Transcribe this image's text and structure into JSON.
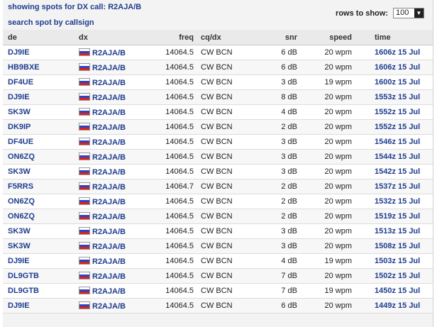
{
  "header": {
    "title_prefix": "showing spots for DX call:",
    "call": "R2AJA/B",
    "search_link": "search spot by callsign",
    "rows_label": "rows to show:",
    "rows_value": "100"
  },
  "columns": {
    "de": "de",
    "dx": "dx",
    "freq": "freq",
    "cqdx": "cq/dx",
    "snr": "snr",
    "speed": "speed",
    "time": "time"
  },
  "rows": [
    {
      "de": "DJ9IE",
      "dx": "R2AJA/B",
      "freq": "14064.5",
      "cqdx": "CW BCN",
      "snr": "6 dB",
      "speed": "20 wpm",
      "time": "1606z 15 Jul"
    },
    {
      "de": "HB9BXE",
      "dx": "R2AJA/B",
      "freq": "14064.5",
      "cqdx": "CW BCN",
      "snr": "6 dB",
      "speed": "20 wpm",
      "time": "1606z 15 Jul"
    },
    {
      "de": "DF4UE",
      "dx": "R2AJA/B",
      "freq": "14064.5",
      "cqdx": "CW BCN",
      "snr": "3 dB",
      "speed": "19 wpm",
      "time": "1600z 15 Jul"
    },
    {
      "de": "DJ9IE",
      "dx": "R2AJA/B",
      "freq": "14064.5",
      "cqdx": "CW BCN",
      "snr": "8 dB",
      "speed": "20 wpm",
      "time": "1553z 15 Jul"
    },
    {
      "de": "SK3W",
      "dx": "R2AJA/B",
      "freq": "14064.5",
      "cqdx": "CW BCN",
      "snr": "4 dB",
      "speed": "20 wpm",
      "time": "1552z 15 Jul"
    },
    {
      "de": "DK9IP",
      "dx": "R2AJA/B",
      "freq": "14064.5",
      "cqdx": "CW BCN",
      "snr": "2 dB",
      "speed": "20 wpm",
      "time": "1552z 15 Jul"
    },
    {
      "de": "DF4UE",
      "dx": "R2AJA/B",
      "freq": "14064.5",
      "cqdx": "CW BCN",
      "snr": "3 dB",
      "speed": "20 wpm",
      "time": "1546z 15 Jul"
    },
    {
      "de": "ON6ZQ",
      "dx": "R2AJA/B",
      "freq": "14064.5",
      "cqdx": "CW BCN",
      "snr": "3 dB",
      "speed": "20 wpm",
      "time": "1544z 15 Jul"
    },
    {
      "de": "SK3W",
      "dx": "R2AJA/B",
      "freq": "14064.5",
      "cqdx": "CW BCN",
      "snr": "3 dB",
      "speed": "20 wpm",
      "time": "1542z 15 Jul"
    },
    {
      "de": "F5RRS",
      "dx": "R2AJA/B",
      "freq": "14064.7",
      "cqdx": "CW BCN",
      "snr": "2 dB",
      "speed": "20 wpm",
      "time": "1537z 15 Jul"
    },
    {
      "de": "ON6ZQ",
      "dx": "R2AJA/B",
      "freq": "14064.5",
      "cqdx": "CW BCN",
      "snr": "2 dB",
      "speed": "20 wpm",
      "time": "1532z 15 Jul"
    },
    {
      "de": "ON6ZQ",
      "dx": "R2AJA/B",
      "freq": "14064.5",
      "cqdx": "CW BCN",
      "snr": "2 dB",
      "speed": "20 wpm",
      "time": "1519z 15 Jul"
    },
    {
      "de": "SK3W",
      "dx": "R2AJA/B",
      "freq": "14064.5",
      "cqdx": "CW BCN",
      "snr": "3 dB",
      "speed": "20 wpm",
      "time": "1513z 15 Jul"
    },
    {
      "de": "SK3W",
      "dx": "R2AJA/B",
      "freq": "14064.5",
      "cqdx": "CW BCN",
      "snr": "3 dB",
      "speed": "20 wpm",
      "time": "1508z 15 Jul"
    },
    {
      "de": "DJ9IE",
      "dx": "R2AJA/B",
      "freq": "14064.5",
      "cqdx": "CW BCN",
      "snr": "4 dB",
      "speed": "19 wpm",
      "time": "1503z 15 Jul"
    },
    {
      "de": "DL9GTB",
      "dx": "R2AJA/B",
      "freq": "14064.5",
      "cqdx": "CW BCN",
      "snr": "7 dB",
      "speed": "20 wpm",
      "time": "1502z 15 Jul"
    },
    {
      "de": "DL9GTB",
      "dx": "R2AJA/B",
      "freq": "14064.5",
      "cqdx": "CW BCN",
      "snr": "7 dB",
      "speed": "19 wpm",
      "time": "1450z 15 Jul"
    },
    {
      "de": "DJ9IE",
      "dx": "R2AJA/B",
      "freq": "14064.5",
      "cqdx": "CW BCN",
      "snr": "6 dB",
      "speed": "20 wpm",
      "time": "1449z 15 Jul"
    }
  ]
}
